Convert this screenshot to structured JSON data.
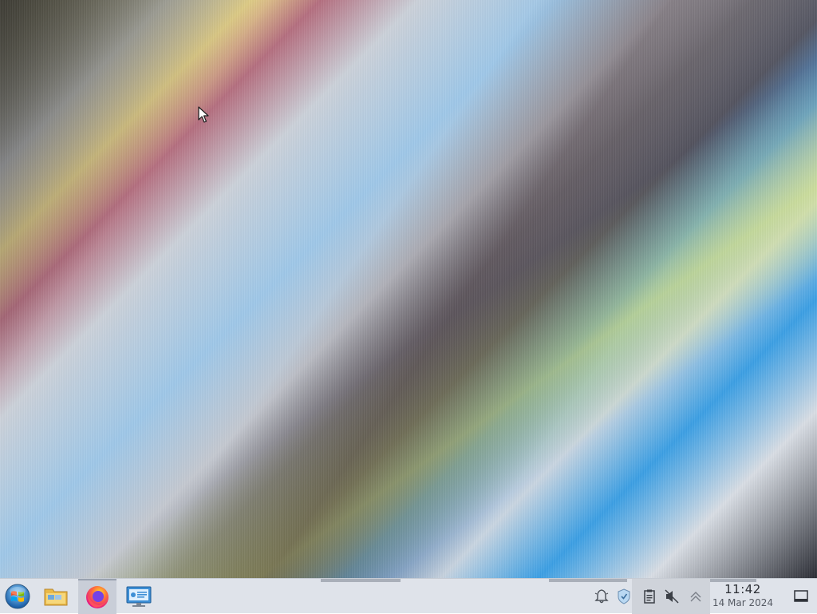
{
  "desktop": {
    "wallpaper": "abstract-diagonal-blur"
  },
  "taskbar": {
    "apps": [
      {
        "name": "Start menu",
        "icon": "start-orb-icon"
      },
      {
        "name": "File manager",
        "icon": "folder-icon"
      },
      {
        "name": "Firefox",
        "icon": "firefox-icon",
        "active": true
      },
      {
        "name": "System monitor",
        "icon": "system-monitor-icon"
      }
    ],
    "tray": {
      "icons": [
        "notification-bell-icon",
        "network-shield-icon",
        "clipboard-icon",
        "volume-muted-icon",
        "expand-tray-icon"
      ]
    },
    "clock": {
      "time": "11:42",
      "date": "14 Mar 2024"
    },
    "colors": {
      "background": "#dfe3ea",
      "active_app": "#c9ced8"
    }
  }
}
